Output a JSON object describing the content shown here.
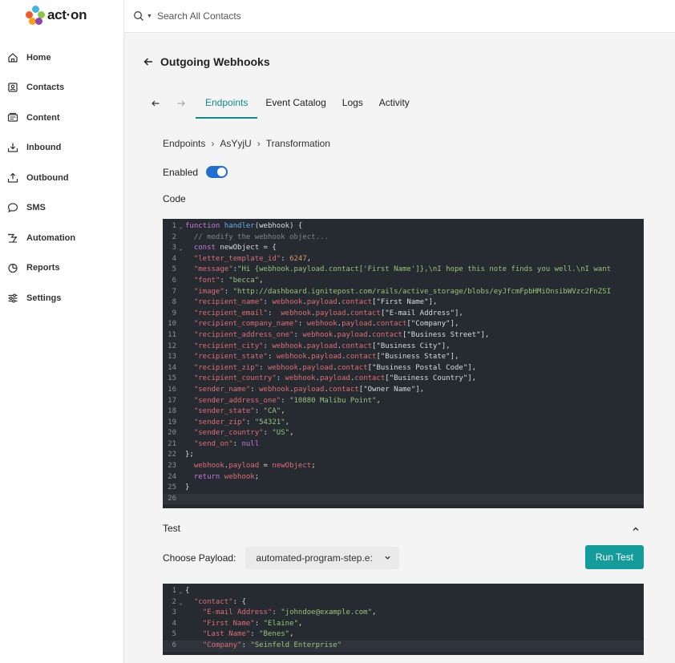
{
  "brand": {
    "logo_text": "act·on",
    "dot_colors": [
      "#3fb4e5",
      "#f15a29",
      "#8dc63f",
      "#f9a11b",
      "#8e44ad"
    ]
  },
  "sidebar": {
    "items": [
      {
        "label": "Home",
        "icon": "home-icon"
      },
      {
        "label": "Contacts",
        "icon": "contacts-icon"
      },
      {
        "label": "Content",
        "icon": "content-icon"
      },
      {
        "label": "Inbound",
        "icon": "inbound-icon"
      },
      {
        "label": "Outbound",
        "icon": "outbound-icon"
      },
      {
        "label": "SMS",
        "icon": "sms-icon"
      },
      {
        "label": "Automation",
        "icon": "automation-icon"
      },
      {
        "label": "Reports",
        "icon": "reports-icon"
      },
      {
        "label": "Settings",
        "icon": "settings-icon"
      }
    ]
  },
  "search": {
    "placeholder": "Search All Contacts"
  },
  "page": {
    "title": "Outgoing Webhooks"
  },
  "tabs": [
    {
      "label": "Endpoints",
      "active": true
    },
    {
      "label": "Event Catalog",
      "active": false
    },
    {
      "label": "Logs",
      "active": false
    },
    {
      "label": "Activity",
      "active": false
    }
  ],
  "breadcrumb": [
    "Endpoints",
    "AsYyjU",
    "Transformation"
  ],
  "enabled": {
    "label": "Enabled",
    "on": true
  },
  "code_section": {
    "label": "Code"
  },
  "code_lines": [
    [
      [
        "kw",
        "function "
      ],
      [
        "fn",
        "handler"
      ],
      [
        "plain",
        "(webhook) {"
      ]
    ],
    [
      [
        "plain",
        "  "
      ],
      [
        "cm",
        "// modify the webhook object..."
      ]
    ],
    [
      [
        "plain",
        "  "
      ],
      [
        "kw",
        "const "
      ],
      [
        "plain",
        "newObject = {"
      ]
    ],
    [
      [
        "plain",
        "  "
      ],
      [
        "prop",
        "\"letter_template_id\""
      ],
      [
        "plain",
        ": "
      ],
      [
        "num",
        "6247"
      ],
      [
        "plain",
        ","
      ]
    ],
    [
      [
        "plain",
        "  "
      ],
      [
        "prop",
        "\"message\""
      ],
      [
        "plain",
        ":"
      ],
      [
        "str",
        "\"Hi {webhook.payload.contact['First Name']},\\nI hope this note finds you well.\\nI want"
      ]
    ],
    [
      [
        "plain",
        "  "
      ],
      [
        "prop",
        "\"font\""
      ],
      [
        "plain",
        ": "
      ],
      [
        "str",
        "\"becca\""
      ],
      [
        "plain",
        ","
      ]
    ],
    [
      [
        "plain",
        "  "
      ],
      [
        "prop",
        "\"image\""
      ],
      [
        "plain",
        ": "
      ],
      [
        "str",
        "\"http://dashboard.ignitepost.com/rails/active_storage/blobs/eyJfcmFpbHMiOnsibWVzc2FnZSI"
      ]
    ],
    [
      [
        "plain",
        "  "
      ],
      [
        "prop",
        "\"recipient_name\""
      ],
      [
        "plain",
        ": "
      ],
      [
        "var",
        "webhook"
      ],
      [
        "plain",
        "."
      ],
      [
        "var",
        "payload"
      ],
      [
        "plain",
        "."
      ],
      [
        "var",
        "contact"
      ],
      [
        "plain",
        "[\"First Name\"],"
      ]
    ],
    [
      [
        "plain",
        "  "
      ],
      [
        "prop",
        "\"recipient_email\""
      ],
      [
        "plain",
        ":  "
      ],
      [
        "var",
        "webhook"
      ],
      [
        "plain",
        "."
      ],
      [
        "var",
        "payload"
      ],
      [
        "plain",
        "."
      ],
      [
        "var",
        "contact"
      ],
      [
        "plain",
        "[\"E-mail Address\"],"
      ]
    ],
    [
      [
        "plain",
        "  "
      ],
      [
        "prop",
        "\"recipient_company_name\""
      ],
      [
        "plain",
        ": "
      ],
      [
        "var",
        "webhook"
      ],
      [
        "plain",
        "."
      ],
      [
        "var",
        "payload"
      ],
      [
        "plain",
        "."
      ],
      [
        "var",
        "contact"
      ],
      [
        "plain",
        "[\"Company\"],"
      ]
    ],
    [
      [
        "plain",
        "  "
      ],
      [
        "prop",
        "\"recipient_address_one\""
      ],
      [
        "plain",
        ": "
      ],
      [
        "var",
        "webhook"
      ],
      [
        "plain",
        "."
      ],
      [
        "var",
        "payload"
      ],
      [
        "plain",
        "."
      ],
      [
        "var",
        "contact"
      ],
      [
        "plain",
        "[\"Business Street\"],"
      ]
    ],
    [
      [
        "plain",
        "  "
      ],
      [
        "prop",
        "\"recipient_city\""
      ],
      [
        "plain",
        ": "
      ],
      [
        "var",
        "webhook"
      ],
      [
        "plain",
        "."
      ],
      [
        "var",
        "payload"
      ],
      [
        "plain",
        "."
      ],
      [
        "var",
        "contact"
      ],
      [
        "plain",
        "[\"Business City\"],"
      ]
    ],
    [
      [
        "plain",
        "  "
      ],
      [
        "prop",
        "\"recipient_state\""
      ],
      [
        "plain",
        ": "
      ],
      [
        "var",
        "webhook"
      ],
      [
        "plain",
        "."
      ],
      [
        "var",
        "payload"
      ],
      [
        "plain",
        "."
      ],
      [
        "var",
        "contact"
      ],
      [
        "plain",
        "[\"Business State\"],"
      ]
    ],
    [
      [
        "plain",
        "  "
      ],
      [
        "prop",
        "\"recipient_zip\""
      ],
      [
        "plain",
        ": "
      ],
      [
        "var",
        "webhook"
      ],
      [
        "plain",
        "."
      ],
      [
        "var",
        "payload"
      ],
      [
        "plain",
        "."
      ],
      [
        "var",
        "contact"
      ],
      [
        "plain",
        "[\"Business Postal Code\"],"
      ]
    ],
    [
      [
        "plain",
        "  "
      ],
      [
        "prop",
        "\"recipient_country\""
      ],
      [
        "plain",
        ": "
      ],
      [
        "var",
        "webhook"
      ],
      [
        "plain",
        "."
      ],
      [
        "var",
        "payload"
      ],
      [
        "plain",
        "."
      ],
      [
        "var",
        "contact"
      ],
      [
        "plain",
        "[\"Business Country\"],"
      ]
    ],
    [
      [
        "plain",
        "  "
      ],
      [
        "prop",
        "\"sender_name\""
      ],
      [
        "plain",
        ": "
      ],
      [
        "var",
        "webhook"
      ],
      [
        "plain",
        "."
      ],
      [
        "var",
        "payload"
      ],
      [
        "plain",
        "."
      ],
      [
        "var",
        "contact"
      ],
      [
        "plain",
        "[\"Owner Name\"],"
      ]
    ],
    [
      [
        "plain",
        "  "
      ],
      [
        "prop",
        "\"sender_address_one\""
      ],
      [
        "plain",
        ": "
      ],
      [
        "str",
        "\"10880 Malibu Point\""
      ],
      [
        "plain",
        ","
      ]
    ],
    [
      [
        "plain",
        "  "
      ],
      [
        "prop",
        "\"sender_state\""
      ],
      [
        "plain",
        ": "
      ],
      [
        "str",
        "\"CA\""
      ],
      [
        "plain",
        ","
      ]
    ],
    [
      [
        "plain",
        "  "
      ],
      [
        "prop",
        "\"sender_zip\""
      ],
      [
        "plain",
        ": "
      ],
      [
        "str",
        "\"54321\""
      ],
      [
        "plain",
        ","
      ]
    ],
    [
      [
        "plain",
        "  "
      ],
      [
        "prop",
        "\"sender_country\""
      ],
      [
        "plain",
        ": "
      ],
      [
        "str",
        "\"US\""
      ],
      [
        "plain",
        ","
      ]
    ],
    [
      [
        "plain",
        "  "
      ],
      [
        "prop",
        "\"send_on\""
      ],
      [
        "plain",
        ": "
      ],
      [
        "kw",
        "null"
      ]
    ],
    [
      [
        "plain",
        "};"
      ]
    ],
    [
      [
        "plain",
        "  "
      ],
      [
        "var",
        "webhook"
      ],
      [
        "plain",
        "."
      ],
      [
        "var",
        "payload"
      ],
      [
        "plain",
        " = "
      ],
      [
        "var",
        "newObject"
      ],
      [
        "plain",
        ";"
      ]
    ],
    [
      [
        "plain",
        "  "
      ],
      [
        "kw",
        "return "
      ],
      [
        "var",
        "webhook"
      ],
      [
        "plain",
        ";"
      ]
    ],
    [
      [
        "plain",
        "}"
      ]
    ],
    [
      [
        "plain",
        ""
      ]
    ]
  ],
  "code_fold_lines": [
    1,
    3
  ],
  "code_active_line": 26,
  "test": {
    "label": "Test",
    "payload_label": "Choose Payload:",
    "payload_value": "automated-program-step.e:",
    "run_label": "Run Test"
  },
  "test_lines": [
    [
      [
        "plain",
        "{"
      ]
    ],
    [
      [
        "plain",
        "  "
      ],
      [
        "prop",
        "\"contact\""
      ],
      [
        "plain",
        ": {"
      ]
    ],
    [
      [
        "plain",
        "    "
      ],
      [
        "prop",
        "\"E-mail Address\""
      ],
      [
        "plain",
        ": "
      ],
      [
        "str",
        "\"johndoe@example.com\""
      ],
      [
        "plain",
        ","
      ]
    ],
    [
      [
        "plain",
        "    "
      ],
      [
        "prop",
        "\"First Name\""
      ],
      [
        "plain",
        ": "
      ],
      [
        "str",
        "\"Elaine\""
      ],
      [
        "plain",
        ","
      ]
    ],
    [
      [
        "plain",
        "    "
      ],
      [
        "prop",
        "\"Last Name\""
      ],
      [
        "plain",
        ": "
      ],
      [
        "str",
        "\"Benes\""
      ],
      [
        "plain",
        ","
      ]
    ],
    [
      [
        "plain",
        "    "
      ],
      [
        "prop",
        "\"Company\""
      ],
      [
        "plain",
        ": "
      ],
      [
        "str",
        "\"Seinfeld Enterprise\""
      ]
    ]
  ],
  "test_fold_lines": [
    1,
    2
  ],
  "test_active_line": 6
}
